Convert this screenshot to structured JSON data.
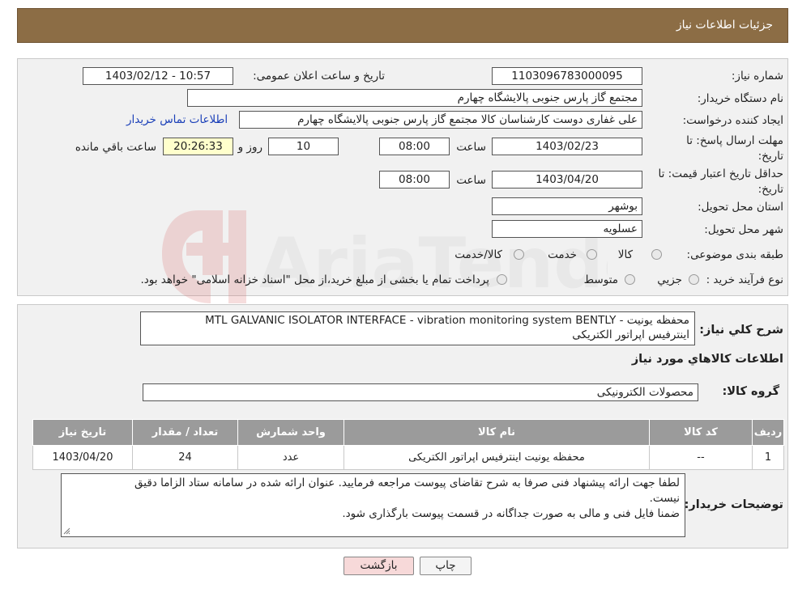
{
  "header": {
    "title": "جزئیات اطلاعات نیاز"
  },
  "form": {
    "need_number_label": "شماره نیاز:",
    "need_number": "1103096783000095",
    "announce_label": "تاریخ و ساعت اعلان عمومی:",
    "announce_value": "1403/02/12 - 10:57",
    "buyer_org_label": "نام دستگاه خریدار:",
    "buyer_org": "مجتمع گاز پارس جنوبی  پالایشگاه چهارم",
    "creator_label": "ایجاد کننده درخواست:",
    "creator": "علی غفاری دوست کارشناسان کالا مجتمع گاز پارس جنوبی  پالایشگاه چهارم",
    "contact_link": "اطلاعات تماس خریدار",
    "deadline_label": "مهلت ارسال پاسخ: تا تاریخ:",
    "deadline_date": "1403/02/23",
    "time_label": "ساعت",
    "deadline_time": "08:00",
    "days_value": "10",
    "days_label": "روز و",
    "remaining_value": "20:26:33",
    "remaining_label": "ساعت باقي مانده",
    "validity_label": "حداقل تاريخ اعتبار قيمت: تا تاریخ:",
    "validity_date": "1403/04/20",
    "validity_time": "08:00",
    "province_label": "استان محل تحویل:",
    "province": "بوشهر",
    "city_label": "شهر محل تحویل:",
    "city": "عسلویه",
    "category_label": "طبقه بندی موضوعی:",
    "category_options": [
      "کالا",
      "خدمت",
      "کالا/خدمت"
    ],
    "process_label": "نوع فرآیند خرید :",
    "process_options": [
      "جزيي",
      "متوسط"
    ],
    "process_note": "پرداخت تمام یا بخشی از مبلغ خرید،از محل \"اسناد خزانه اسلامی\" خواهد بود."
  },
  "summary": {
    "label": "شرح كلي نياز:",
    "line1": "محفظه یونیت      -  MTL  GALVANIC ISOLATOR INTERFACE  -  vibration monitoring system BENTLY",
    "line2": "اینترفیس اپراتور الکتریکی"
  },
  "goods": {
    "section_title": "اطلاعات كالاهاي مورد نياز",
    "group_label": "گروه کالا:",
    "group_value": "محصولات الکترونیکی",
    "columns": [
      "رديف",
      "كد كالا",
      "نام كالا",
      "واحد شمارش",
      "تعداد / مقدار",
      "تاريخ نياز"
    ],
    "rows": [
      [
        "1",
        "--",
        "محفظه یونیت اینترفیس اپراتور الکتریکی",
        "عدد",
        "24",
        "1403/04/20"
      ]
    ]
  },
  "notes": {
    "label": "توضیحات خریدار:",
    "line1": "لطفا جهت ارائه پیشنهاد فنی صرفا به شرح تقاضای پیوست مراجعه فرمایید. عنوان ارائه شده در سامانه ستاد الزاما دقیق",
    "line2": "نیست.",
    "line3": "ضمنا فایل فنی و مالی به صورت جداگانه در قسمت پیوست بارگذاری شود."
  },
  "buttons": {
    "back": "بازگشت",
    "print": "چاپ"
  },
  "watermark": {
    "text": "AriaTender.neT"
  },
  "colors": {
    "header": "#8c6d45",
    "link": "#1a3fb8",
    "back_button": "#f7d9d9",
    "remaining_box": "#ffffcc"
  }
}
